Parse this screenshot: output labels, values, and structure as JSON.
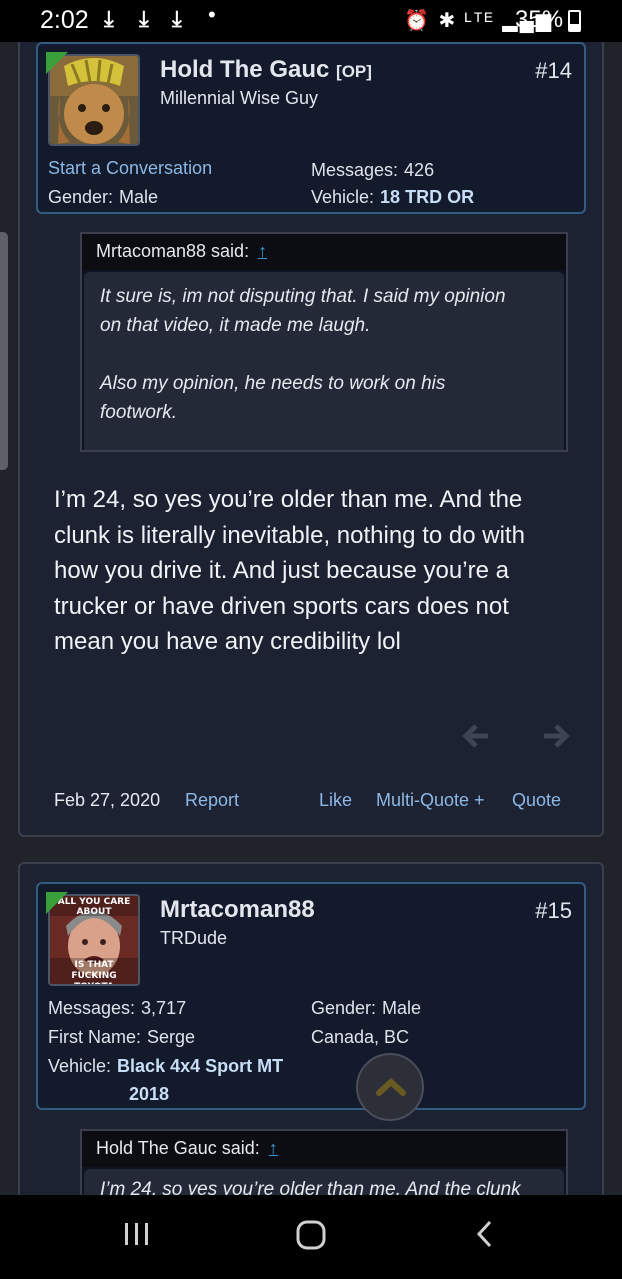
{
  "status_bar": {
    "time": "2:02",
    "download_icons": [
      "⤓",
      "⤓",
      "⤓"
    ],
    "dot": "•",
    "icons_text": "⏰ ✱ ᴸᵀᴱ ▂▄▆",
    "battery": "35%"
  },
  "post1": {
    "author": "Hold The Gauc",
    "op_badge": "[OP]",
    "user_title": "Millennial Wise Guy",
    "post_number": "#14",
    "start_conversation": "Start a Conversation",
    "gender_label": "Gender:",
    "gender_value": "Male",
    "messages_label": "Messages:",
    "messages_value": "426",
    "vehicle_label": "Vehicle:",
    "vehicle_value": "18 TRD OR",
    "quote": {
      "author_line": "Mrtacoman88 said:",
      "arrow": "↑",
      "paragraph1_line1": "It sure is, im not disputing that. I said my opinion",
      "paragraph1_line2": "on that video, it made me laugh.",
      "paragraph2_line1": "Also my opinion, he needs to work on his",
      "paragraph2_line2": "footwork."
    },
    "message": "I’m 24, so yes you’re older than me. And the clunk is literally inevitable, nothing to do with how you drive it. And just because you’re a trucker or have driven sports cars does not mean you have any credibility lol",
    "date": "Feb 27, 2020",
    "report": "Report",
    "like": "Like",
    "multiquote": "Multi-Quote +",
    "quote_action": "Quote"
  },
  "post2": {
    "author": "Mrtacoman88",
    "user_title": "TRDude",
    "post_number": "#15",
    "messages_label": "Messages:",
    "messages_value": "3,717",
    "firstname_label": "First Name:",
    "firstname_value": "Serge",
    "vehicle_label": "Vehicle:",
    "vehicle_value_line1": "Black 4x4 Sport MT",
    "vehicle_value_line2": "2018",
    "gender_label": "Gender:",
    "gender_value": "Male",
    "location": "Canada, BC",
    "avatar_text_top": "ALL YOU CARE ABOUT",
    "avatar_text_bottom": "IS THAT FUCKING TOYOTA",
    "quote": {
      "author_line": "Hold The Gauc said:",
      "arrow": "↑",
      "preview": "I’m 24, so yes you’re older than me. And the clunk"
    }
  },
  "colors": {
    "background": "#21232a",
    "card": "#1d2232",
    "userbox_border": "#2f5d84",
    "link": "#8cb8e6",
    "online": "#3aa13a"
  }
}
